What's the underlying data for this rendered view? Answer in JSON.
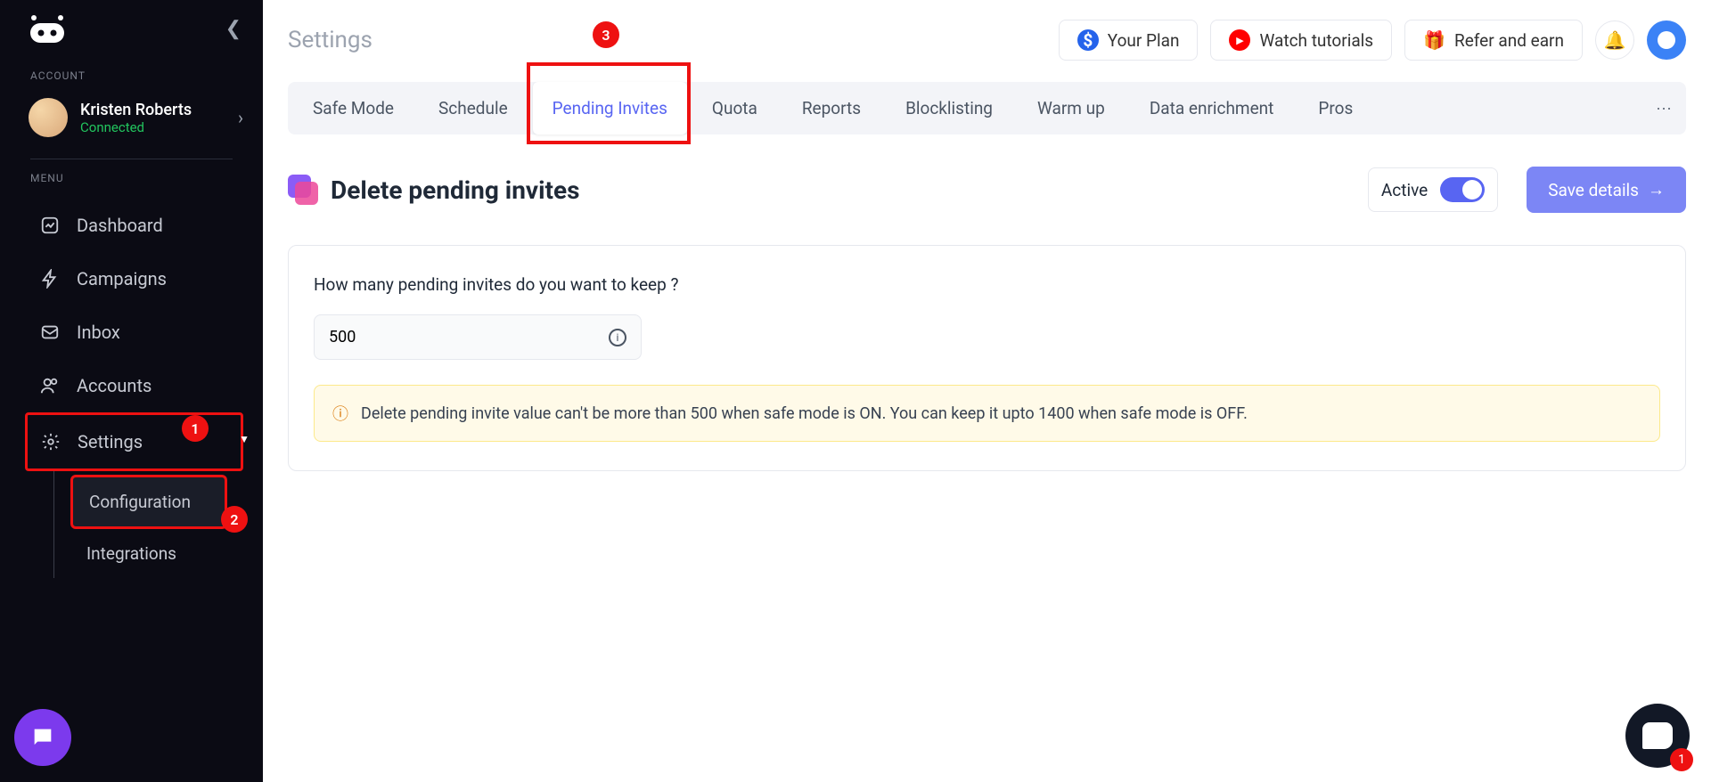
{
  "sidebar": {
    "section_account": "ACCOUNT",
    "user_name": "Kristen Roberts",
    "user_status": "Connected",
    "section_menu": "MENU",
    "items": [
      "Dashboard",
      "Campaigns",
      "Inbox",
      "Accounts",
      "Settings"
    ],
    "submenu": [
      "Configuration",
      "Integrations"
    ]
  },
  "badges": {
    "n1": "1",
    "n2": "2",
    "n3": "3"
  },
  "header": {
    "page_title": "Settings",
    "plan": "Your Plan",
    "tutorials": "Watch tutorials",
    "refer": "Refer and earn"
  },
  "tabs": [
    "Safe Mode",
    "Schedule",
    "Pending Invites",
    "Quota",
    "Reports",
    "Blocklisting",
    "Warm up",
    "Data enrichment",
    "Pros"
  ],
  "section": {
    "title": "Delete pending invites",
    "active_label": "Active",
    "save_label": "Save details"
  },
  "card": {
    "question": "How many pending invites do you want to keep ?",
    "input_value": "500",
    "alert": "Delete pending invite value can't be more than 500 when safe mode is ON. You can keep it upto 1400 when safe mode is OFF."
  },
  "chat_badge": "1"
}
